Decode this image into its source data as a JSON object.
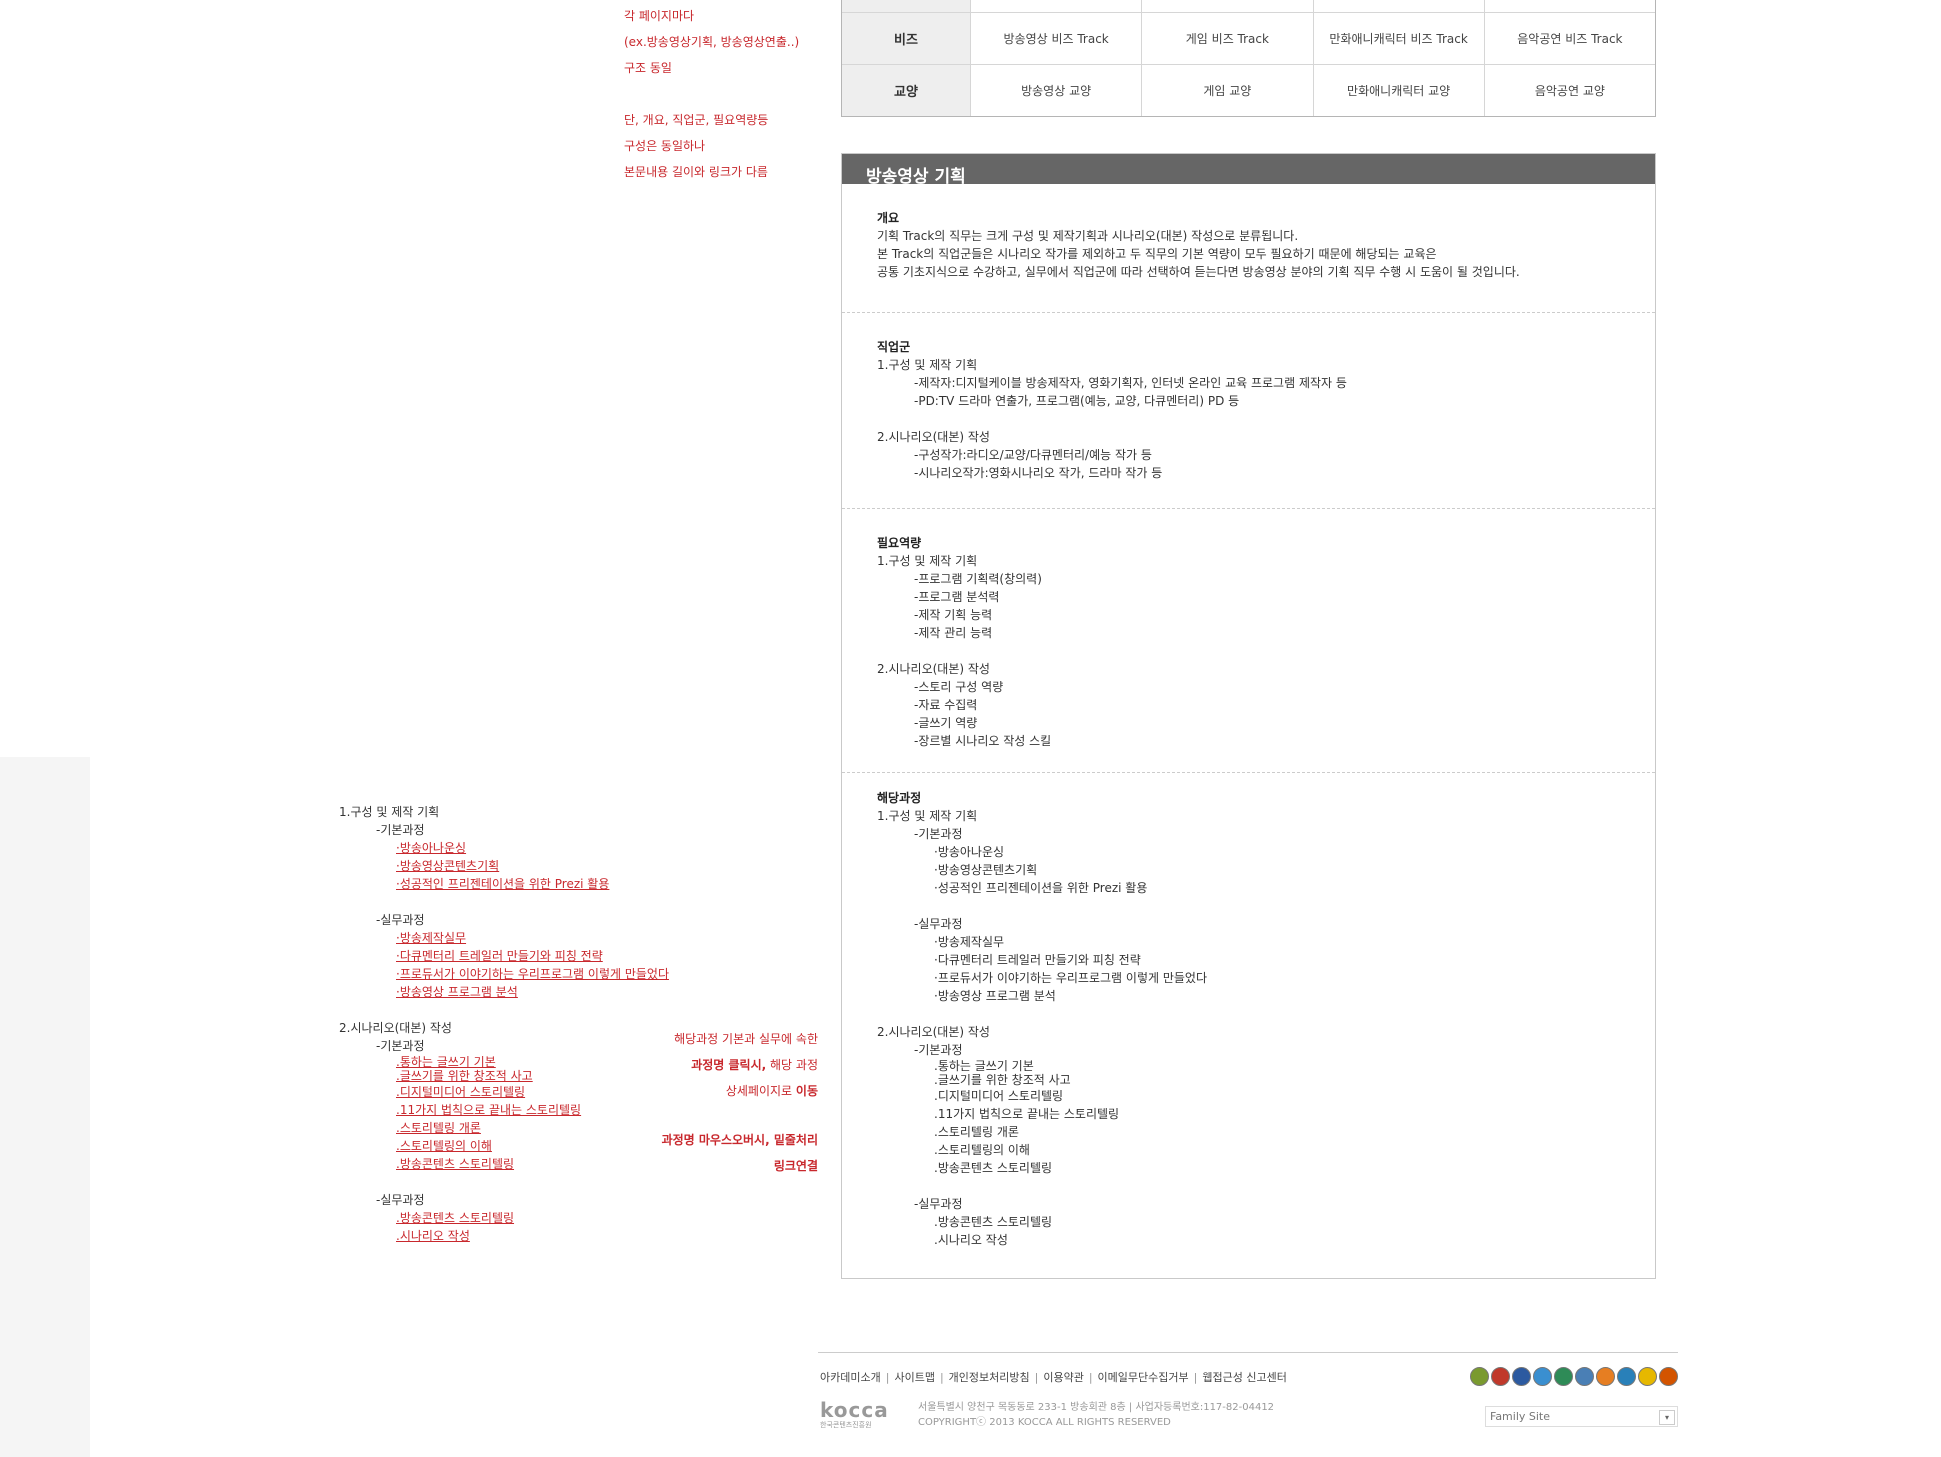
{
  "notes": {
    "top": [
      "각 페이지마다",
      "(ex.방송영상기획, 방송영상연출..)",
      "구조 동일"
    ],
    "mid": [
      "단, 개요, 직업군, 필요역량등",
      "구성은 동일하나",
      "본문내용 길이와 링크가 다름"
    ],
    "click": {
      "l1_bold": "과정명 클릭시,",
      "l1_rest": " 해당 과정",
      "l0": "해당과정 기본과 실무에 속한",
      "l2_rest": "상세페이지로 ",
      "l2_bold": "이동"
    },
    "hover": [
      "과정명 마우스오버시, 밑줄처리",
      "링크연결"
    ]
  },
  "track_table": {
    "rows": [
      {
        "label": "비즈",
        "cells": [
          "방송영상 비즈 Track",
          "게임 비즈 Track",
          "만화애니캐릭터 비즈 Track",
          "음악공연 비즈 Track"
        ]
      },
      {
        "label": "교양",
        "cells": [
          "방송영상 교양",
          "게임 교양",
          "만화애니캐릭터 교양",
          "음악공연 교양"
        ]
      }
    ]
  },
  "panel": {
    "title": "방송영상 기획",
    "overview": {
      "heading": "개요",
      "lines": [
        "기획 Track의 직무는 크게 구성 및 제작기획과 시나리오(대본) 작성으로 분류됩니다.",
        "본 Track의 직업군들은 시나리오 작가를 제외하고 두 직무의 기본 역량이 모두 필요하기 때문에 해당되는 교육은",
        "공통 기초지식으로 수강하고, 실무에서 직업군에 따라 선택하여 듣는다면 방송영상 분야의 기획 직무 수행 시 도움이 될 것입니다."
      ]
    },
    "jobs": {
      "heading": "직업군",
      "g1": "1.구성 및 제작 기획",
      "g1_items": [
        "-제작자:디지털케이블 방송제작자, 영화기획자, 인터넷 온라인 교육 프로그램 제작자 등",
        "-PD:TV 드라마 연출가, 프로그램(예능, 교양, 다큐멘터리) PD 등"
      ],
      "g2": "2.시나리오(대본) 작성",
      "g2_items": [
        "-구성작가:라디오/교양/다큐멘터리/예능 작가 등",
        "-시나리오작가:영화시나리오 작가, 드라마 작가 등"
      ]
    },
    "competency": {
      "heading": "필요역량",
      "g1": "1.구성 및 제작 기획",
      "g1_items": [
        "-프로그램 기획력(창의력)",
        "-프로그램 분석력",
        "-제작 기획 능력",
        "-제작 관리 능력"
      ],
      "g2": "2.시나리오(대본) 작성",
      "g2_items": [
        "-스토리 구성 역량",
        "-자료 수집력",
        "-글쓰기 역량",
        "-장르별 시나리오 작성 스킬"
      ]
    },
    "courses": {
      "heading": "해당과정",
      "g1": "1.구성 및 제작 기획",
      "basic": "-기본과정",
      "practice": "-실무과정",
      "g1_basic": [
        "·방송아나운싱",
        "·방송영상콘텐츠기획",
        "·성공적인 프리젠테이션을 위한 Prezi 활용"
      ],
      "g1_practice": [
        "·방송제작실무",
        "·다큐멘터리 트레일러 만들기와 피칭 전략",
        "·프로듀서가 이야기하는 우리프로그램 이렇게 만들었다",
        "·방송영상 프로그램 분석"
      ],
      "g2": "2.시나리오(대본) 작성",
      "g2_basic": [
        ".통하는 글쓰기 기본",
        ".글쓰기를 위한 창조적 사고",
        ".디지털미디어 스토리텔링",
        ".11가지 법칙으로 끝내는 스토리텔링",
        ".스토리텔링 개론",
        ".스토리텔링의 이해",
        ".방송콘텐츠 스토리텔링"
      ],
      "g2_practice": [
        ".방송콘텐츠 스토리텔링",
        ".시나리오 작성"
      ]
    }
  },
  "left_list": {
    "g1": "1.구성 및 제작 기획",
    "basic": "-기본과정",
    "practice": "-실무과정",
    "g1_basic": [
      "·방송아나운싱",
      "·방송영상콘텐츠기획",
      "·성공적인 프리젠테이션을 위한 Prezi 활용"
    ],
    "g1_practice": [
      "·방송제작실무",
      "·다큐멘터리 트레일러 만들기와 피칭 전략",
      "·프로듀서가 이야기하는 우리프로그램 이렇게 만들었다",
      "·방송영상 프로그램 분석"
    ],
    "g2": "2.시나리오(대본) 작성",
    "g2_basic": [
      ".통하는 글쓰기 기본",
      ".글쓰기를 위한 창조적 사고",
      ".디지털미디어 스토리텔링",
      ".11가지 법칙으로 끝내는 스토리텔링",
      ".스토리텔링 개론",
      ".스토리텔링의 이해",
      ".방송콘텐츠 스토리텔링"
    ],
    "g2_practice": [
      ".방송콘텐츠 스토리텔링",
      ".시나리오 작성"
    ]
  },
  "footer": {
    "links": [
      "아카데미소개",
      "사이트맵",
      "개인정보처리방침",
      "이용약관",
      "이메일무단수집거부",
      "웹접근성 신고센터"
    ],
    "logo": "kocca",
    "logo_sub": "한국콘텐츠진흥원",
    "address": "서울특별시 양천구 목동동로 233-1 방송회관 8층 | 사업자등록번호:117-82-04412",
    "copyright": "COPYRIGHTⓒ 2013 KOCCA ALL RIGHTS RESERVED",
    "family_site": "Family Site",
    "family_arrow": "▾",
    "badge_colors": [
      "#7a9a2f",
      "#c0392b",
      "#2c5aa0",
      "#3a8fd0",
      "#2e8b57",
      "#4a7fb5",
      "#e67e22",
      "#2980b9",
      "#e6b800",
      "#d35400"
    ]
  }
}
